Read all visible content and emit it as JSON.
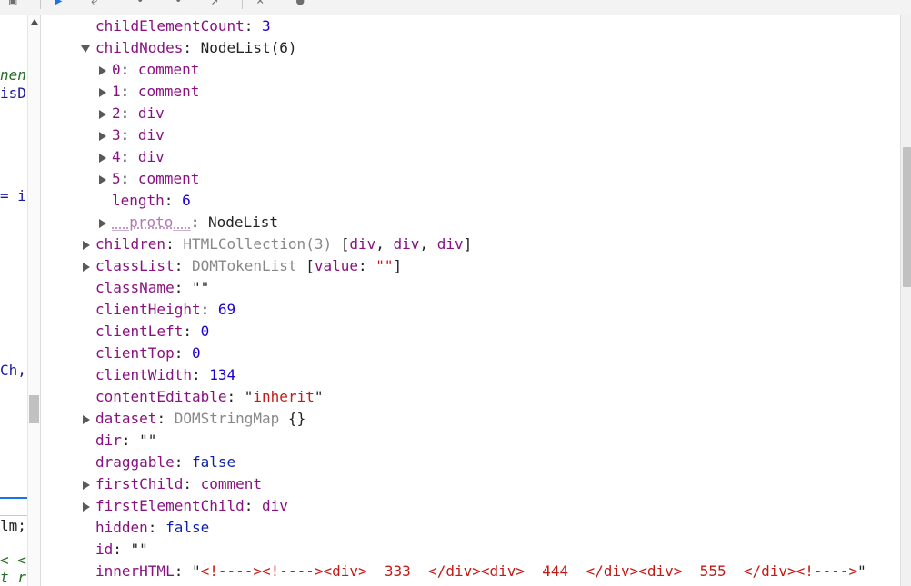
{
  "toolbar": {
    "icons": [
      "panel-icon",
      "inspect-icon",
      "step-over-icon",
      "step-icon",
      "step-into-icon",
      "step-out-icon",
      "deactivate-icon",
      "pause-icon"
    ]
  },
  "left_code": [
    {
      "text": "nen",
      "color": "#236e25",
      "italic": true
    },
    {
      "text": "isD",
      "color": "#1a1aa6",
      "italic": false
    },
    {
      "text": "= i",
      "color": "#1a1aa6",
      "italic": false
    },
    {
      "text": "Ch, ",
      "color": "#1a1aa6",
      "italic": false
    },
    {
      "text": "lm;",
      "color": "#222222",
      "italic": false
    },
    {
      "text": "< <t",
      "color": "#236e25",
      "italic": true
    },
    {
      "text": "t r",
      "color": "#236e25",
      "italic": true
    }
  ],
  "properties": [
    {
      "key": "childElementCount",
      "value": "3",
      "vtype": "num",
      "indent": 0,
      "toggle": "none"
    },
    {
      "key": "childNodes",
      "value": "NodeList(6)",
      "vtype": "obj",
      "indent": 0,
      "toggle": "down"
    },
    {
      "key": "0",
      "value": "comment",
      "vtype": "node",
      "indent": 1,
      "toggle": "right"
    },
    {
      "key": "1",
      "value": "comment",
      "vtype": "node",
      "indent": 1,
      "toggle": "right"
    },
    {
      "key": "2",
      "value": "div",
      "vtype": "node",
      "indent": 1,
      "toggle": "right"
    },
    {
      "key": "3",
      "value": "div",
      "vtype": "node",
      "indent": 1,
      "toggle": "right"
    },
    {
      "key": "4",
      "value": "div",
      "vtype": "node",
      "indent": 1,
      "toggle": "right"
    },
    {
      "key": "5",
      "value": "comment",
      "vtype": "node",
      "indent": 1,
      "toggle": "right"
    },
    {
      "key": "length",
      "value": "6",
      "vtype": "num",
      "indent": 1,
      "toggle": "none"
    },
    {
      "key": "__proto__",
      "value": "NodeList",
      "vtype": "obj",
      "indent": 1,
      "toggle": "right",
      "proto": true
    },
    {
      "key": "children",
      "value": "",
      "vtype": "collection",
      "indent": 0,
      "toggle": "right",
      "parts": [
        {
          "t": "HTMLCollection(3) ",
          "c": "gray"
        },
        {
          "t": "[",
          "c": "p"
        },
        {
          "t": "div",
          "c": "node"
        },
        {
          "t": ", ",
          "c": "p"
        },
        {
          "t": "div",
          "c": "node"
        },
        {
          "t": ", ",
          "c": "p"
        },
        {
          "t": "div",
          "c": "node"
        },
        {
          "t": "]",
          "c": "p"
        }
      ]
    },
    {
      "key": "classList",
      "value": "",
      "vtype": "collection",
      "indent": 0,
      "toggle": "right",
      "parts": [
        {
          "t": "DOMTokenList ",
          "c": "gray"
        },
        {
          "t": "[",
          "c": "p"
        },
        {
          "t": "value",
          "c": "k"
        },
        {
          "t": ": ",
          "c": "p"
        },
        {
          "t": "\"\"",
          "c": "str"
        },
        {
          "t": "]",
          "c": "p"
        }
      ]
    },
    {
      "key": "className",
      "value": "\"\"",
      "vtype": "plain",
      "indent": 0,
      "toggle": "none"
    },
    {
      "key": "clientHeight",
      "value": "69",
      "vtype": "num",
      "indent": 0,
      "toggle": "none"
    },
    {
      "key": "clientLeft",
      "value": "0",
      "vtype": "num",
      "indent": 0,
      "toggle": "none"
    },
    {
      "key": "clientTop",
      "value": "0",
      "vtype": "num",
      "indent": 0,
      "toggle": "none"
    },
    {
      "key": "clientWidth",
      "value": "134",
      "vtype": "num",
      "indent": 0,
      "toggle": "none"
    },
    {
      "key": "contentEditable",
      "value": "",
      "vtype": "collection",
      "indent": 0,
      "toggle": "none",
      "parts": [
        {
          "t": "\"",
          "c": "p"
        },
        {
          "t": "inherit",
          "c": "str"
        },
        {
          "t": "\"",
          "c": "p"
        }
      ]
    },
    {
      "key": "dataset",
      "value": "",
      "vtype": "collection",
      "indent": 0,
      "toggle": "right",
      "parts": [
        {
          "t": "DOMStringMap ",
          "c": "gray"
        },
        {
          "t": "{}",
          "c": "p"
        }
      ]
    },
    {
      "key": "dir",
      "value": "\"\"",
      "vtype": "plain",
      "indent": 0,
      "toggle": "none"
    },
    {
      "key": "draggable",
      "value": "false",
      "vtype": "bool",
      "indent": 0,
      "toggle": "none"
    },
    {
      "key": "firstChild",
      "value": "comment",
      "vtype": "node",
      "indent": 0,
      "toggle": "right"
    },
    {
      "key": "firstElementChild",
      "value": "div",
      "vtype": "node",
      "indent": 0,
      "toggle": "right"
    },
    {
      "key": "hidden",
      "value": "false",
      "vtype": "bool",
      "indent": 0,
      "toggle": "none"
    },
    {
      "key": "id",
      "value": "\"\"",
      "vtype": "plain",
      "indent": 0,
      "toggle": "none"
    },
    {
      "key": "innerHTML",
      "value": "",
      "vtype": "collection",
      "indent": 0,
      "toggle": "none",
      "parts": [
        {
          "t": "\"",
          "c": "p"
        },
        {
          "t": "<!----><!----><div>  333  </div><div>  444  </div><div>  555  </div><!---->",
          "c": "str"
        },
        {
          "t": "\"",
          "c": "p"
        }
      ]
    }
  ],
  "colors": {
    "key": "#881280",
    "number": "#1c00cf",
    "string": "#c41a16",
    "boolean": "#0d22aa",
    "gray": "#888888"
  }
}
